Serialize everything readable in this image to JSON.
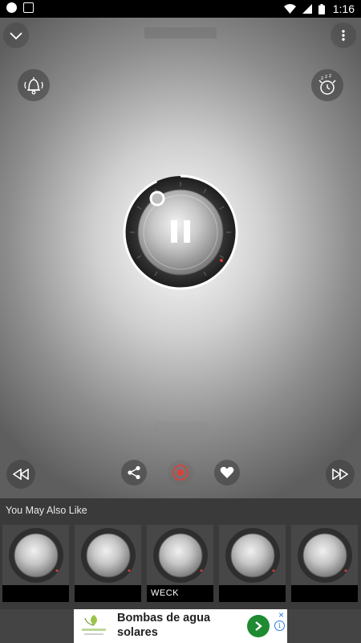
{
  "status_bar": {
    "time": "1:16"
  },
  "suggestions": {
    "title": "You May Also Like",
    "items": [
      {
        "caption": ""
      },
      {
        "caption": ""
      },
      {
        "caption": "WECK"
      },
      {
        "caption": ""
      },
      {
        "caption": ""
      }
    ]
  },
  "ad": {
    "headline": "Bombas de agua solares",
    "info": "i",
    "close": "×"
  },
  "colors": {
    "record_accent": "#d9413a",
    "ad_button": "#1e8a32",
    "ad_info": "#2a7de1"
  },
  "icons": [
    "chevron-down-icon",
    "more-vert-icon",
    "bell-ringing-icon",
    "sleep-timer-icon",
    "pause-icon",
    "rewind-icon",
    "share-icon",
    "record-icon",
    "heart-icon",
    "fast-forward-icon"
  ]
}
